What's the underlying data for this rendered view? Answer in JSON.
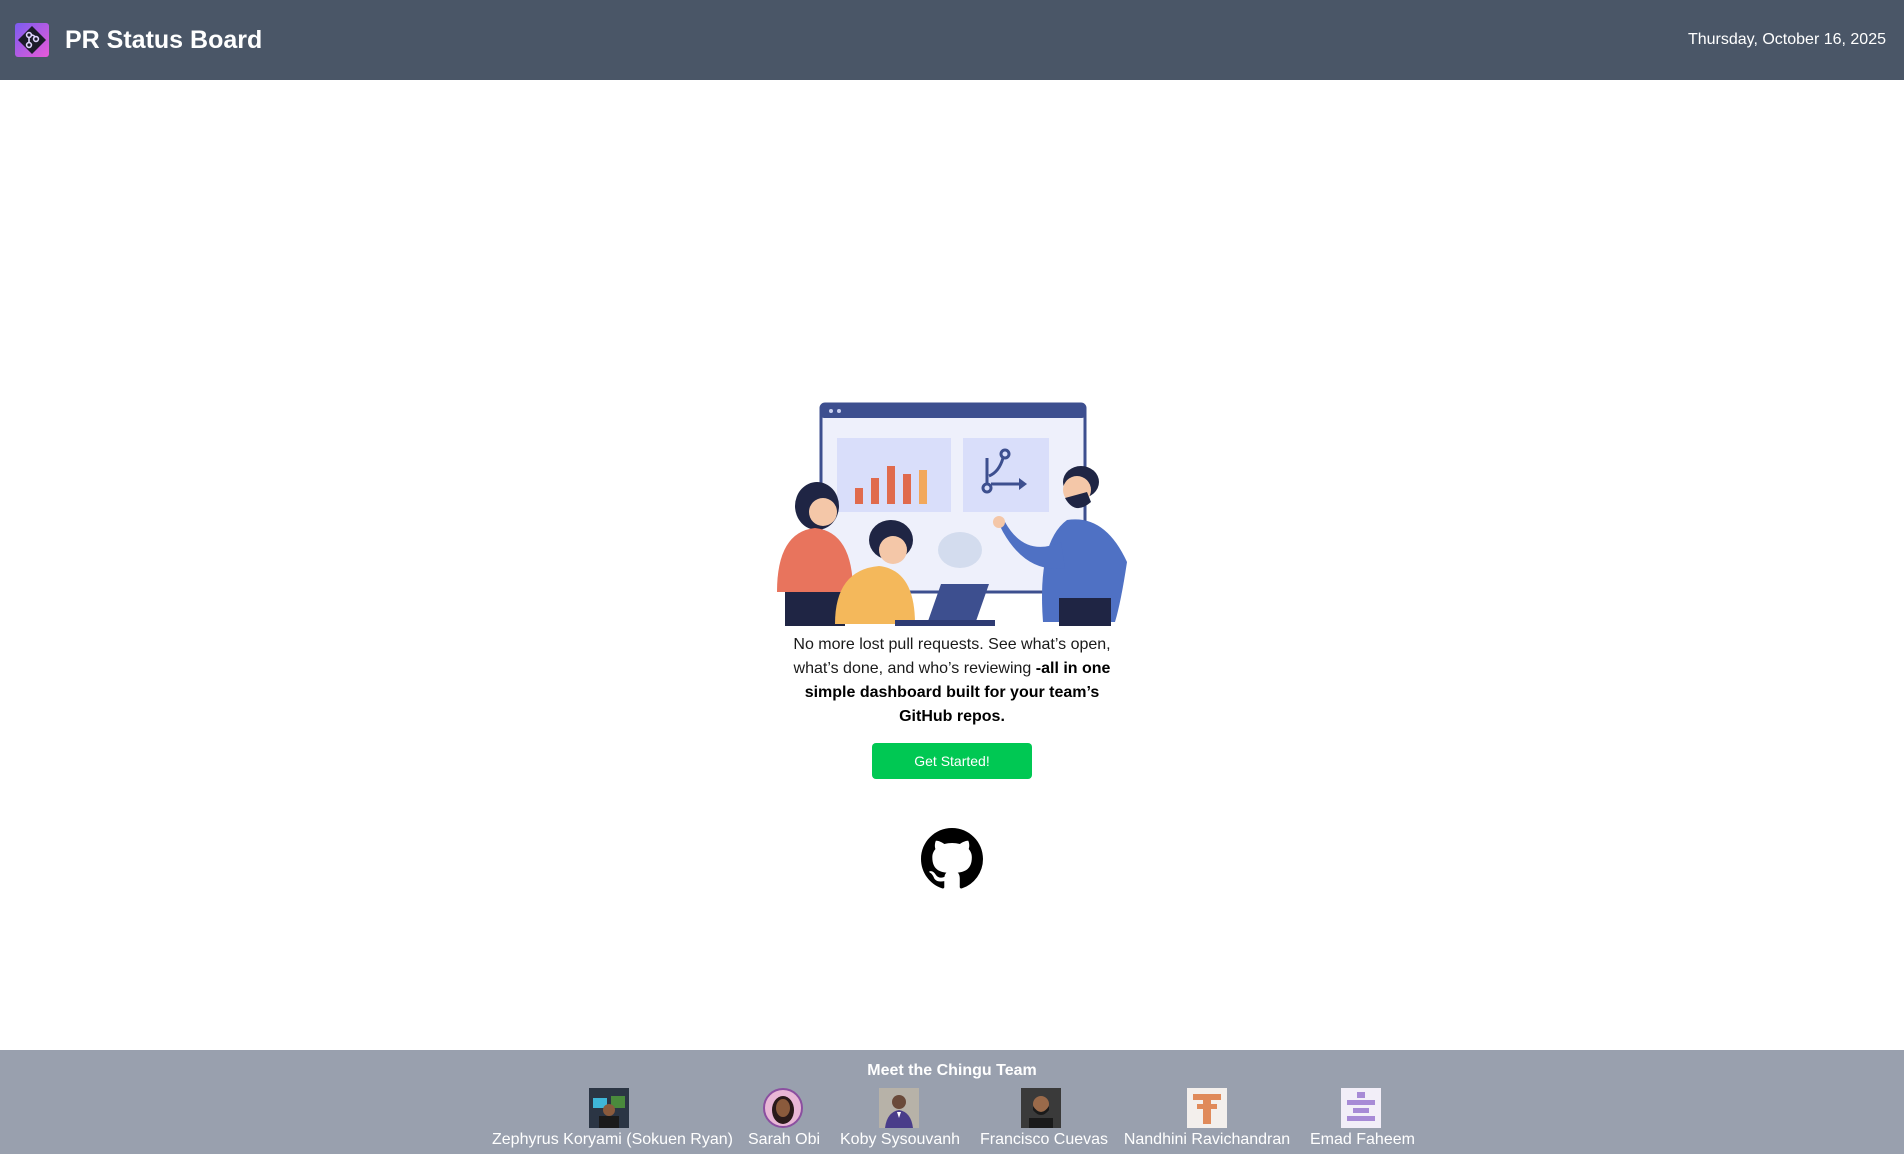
{
  "header": {
    "app_title": "PR Status Board",
    "logo_icon": "git-branch-logo-icon",
    "date": "Thursday, October 16, 2025"
  },
  "hero": {
    "illustration": "team-dashboard-illustration",
    "tagline_line1": "No more lost pull requests. See what’s open, what’s done, and who’s reviewing",
    "tagline_strong": "-all in one simple dashboard built for your team’s GitHub repos.",
    "cta_label": "Get Started!",
    "github_icon": "github-icon"
  },
  "footer": {
    "title": "Meet the Chingu Team",
    "members": [
      {
        "name": "Zephyrus Koryami (Sokuen Ryan)"
      },
      {
        "name": "Sarah Obi"
      },
      {
        "name": "Koby Sysouvanh"
      },
      {
        "name": "Francisco Cuevas"
      },
      {
        "name": "Nandhini Ravichandran"
      },
      {
        "name": "Emad Faheem"
      }
    ]
  },
  "colors": {
    "header_bg": "#4a5667",
    "footer_bg": "#99a0ae",
    "cta_bg": "#00c853"
  }
}
